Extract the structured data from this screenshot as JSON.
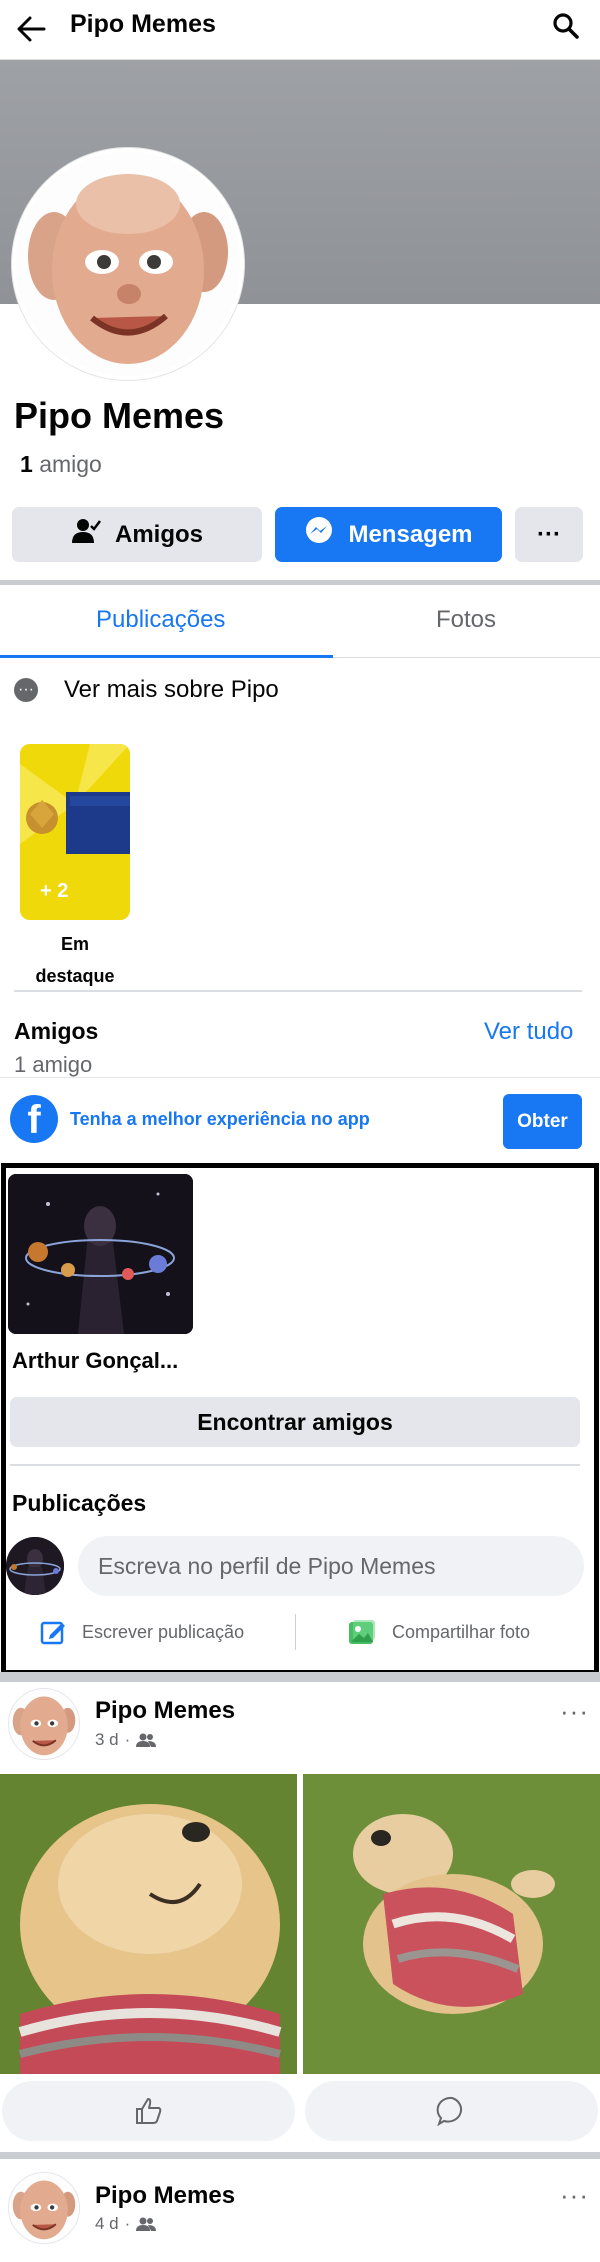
{
  "header": {
    "title": "Pipo Memes"
  },
  "profile": {
    "name": "Pipo Memes",
    "friends_count": "1",
    "friends_word": "amigo"
  },
  "actions": {
    "friends_label": "Amigos",
    "message_label": "Mensagem",
    "more_label": "···"
  },
  "tabs": [
    {
      "label": "Publicações",
      "active": true
    },
    {
      "label": "Fotos",
      "active": false
    }
  ],
  "about": {
    "label": "Ver mais sobre Pipo"
  },
  "highlights": {
    "extra": "+ 2",
    "label": "Em destaque"
  },
  "friends_section": {
    "title": "Amigos",
    "see_all": "Ver tudo",
    "count_text": "1 amigo",
    "friend_name": "Arthur Gonçal...",
    "find_button": "Encontrar amigos"
  },
  "app_banner": {
    "text": "Tenha a melhor experiência no app",
    "button": "Obter"
  },
  "publications": {
    "title": "Publicações",
    "composer_placeholder": "Escreva no perfil de Pipo Memes",
    "write_label": "Escrever publicação",
    "share_photo_label": "Compartilhar foto"
  },
  "posts": [
    {
      "author": "Pipo Memes",
      "time": "3 d",
      "more": "···"
    },
    {
      "author": "Pipo Memes",
      "time": "4 d",
      "more": "···"
    }
  ],
  "colors": {
    "accent": "#1877f2",
    "secondary_bg": "#e4e6eb",
    "muted_text": "#65676b"
  }
}
